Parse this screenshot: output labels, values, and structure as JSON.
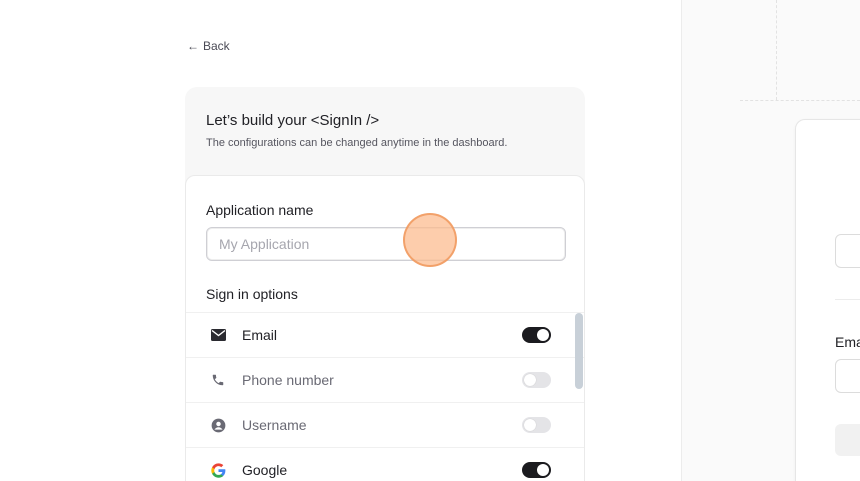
{
  "nav": {
    "back_label": "Back",
    "back_icon": "arrow-left-icon"
  },
  "header": {
    "title": "Let’s build your <SignIn />",
    "subtitle": "The configurations can be changed anytime in the dashboard."
  },
  "form": {
    "app_name_label": "Application name",
    "app_name_value": "",
    "app_name_placeholder": "My Application",
    "sign_in_options_label": "Sign in options",
    "options": [
      {
        "label": "Email",
        "icon": "mail-icon",
        "enabled": true
      },
      {
        "label": "Phone number",
        "icon": "phone-icon",
        "enabled": false
      },
      {
        "label": "Username",
        "icon": "user-circle-icon",
        "enabled": false
      },
      {
        "label": "Google",
        "icon": "google-icon",
        "enabled": true
      }
    ]
  },
  "preview": {
    "field_label": "Email"
  },
  "colors": {
    "toggle_on": "#1b1b1f",
    "toggle_off": "#e4e4e7",
    "click_marker": "#fcba8c"
  }
}
